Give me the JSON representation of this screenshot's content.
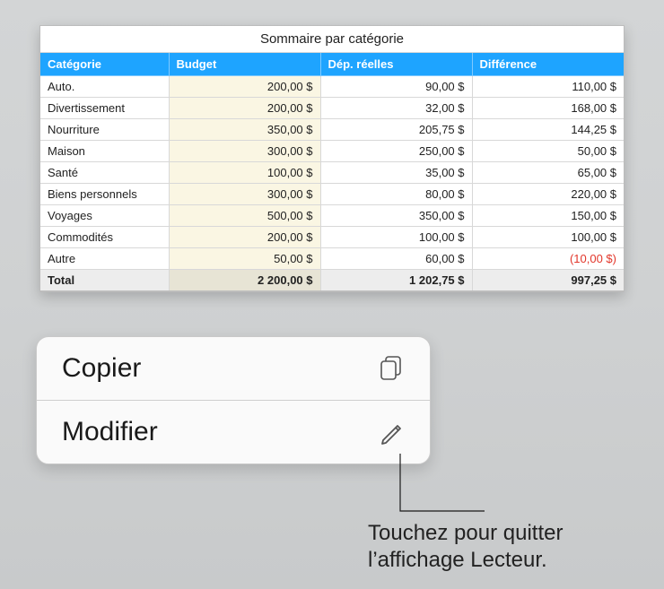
{
  "table": {
    "title": "Sommaire par catégorie",
    "headers": [
      "Catégorie",
      "Budget",
      "Dép. réelles",
      "Différence"
    ],
    "rows": [
      {
        "cat": "Auto.",
        "budget": "200,00 $",
        "actual": "90,00 $",
        "diff": "110,00 $",
        "neg": false
      },
      {
        "cat": "Divertissement",
        "budget": "200,00 $",
        "actual": "32,00 $",
        "diff": "168,00 $",
        "neg": false
      },
      {
        "cat": "Nourriture",
        "budget": "350,00 $",
        "actual": "205,75 $",
        "diff": "144,25 $",
        "neg": false
      },
      {
        "cat": "Maison",
        "budget": "300,00 $",
        "actual": "250,00 $",
        "diff": "50,00 $",
        "neg": false
      },
      {
        "cat": "Santé",
        "budget": "100,00 $",
        "actual": "35,00 $",
        "diff": "65,00 $",
        "neg": false
      },
      {
        "cat": "Biens personnels",
        "budget": "300,00 $",
        "actual": "80,00 $",
        "diff": "220,00 $",
        "neg": false
      },
      {
        "cat": "Voyages",
        "budget": "500,00 $",
        "actual": "350,00 $",
        "diff": "150,00 $",
        "neg": false
      },
      {
        "cat": "Commodités",
        "budget": "200,00 $",
        "actual": "100,00 $",
        "diff": "100,00 $",
        "neg": false
      },
      {
        "cat": "Autre",
        "budget": "50,00 $",
        "actual": "60,00 $",
        "diff": "(10,00 $)",
        "neg": true
      }
    ],
    "total": {
      "cat": "Total",
      "budget": "2 200,00 $",
      "actual": "1 202,75 $",
      "diff": "997,25 $"
    }
  },
  "menu": {
    "copy": {
      "label": "Copier",
      "icon": "copy-icon"
    },
    "modify": {
      "label": "Modifier",
      "icon": "pencil-icon"
    }
  },
  "callout": {
    "line1": "Touchez pour quitter",
    "line2": "l’affichage Lecteur."
  }
}
